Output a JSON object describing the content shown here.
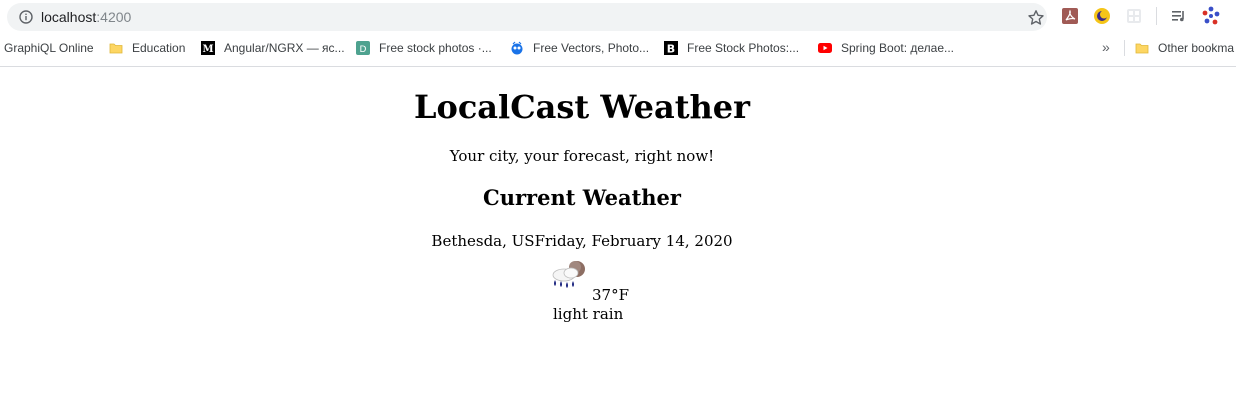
{
  "browser": {
    "url_host": "localhost",
    "url_port": ":4200",
    "bookmarks": [
      {
        "label": "GraphiQL Online",
        "icon": "none"
      },
      {
        "label": "Education",
        "icon": "folder-icon"
      },
      {
        "label": "Angular/NGRX — яс...",
        "icon": "medium-icon"
      },
      {
        "label": "Free stock photos ·...",
        "icon": "d-icon"
      },
      {
        "label": "Free Vectors, Photo...",
        "icon": "freepik-icon"
      },
      {
        "label": "Free Stock Photos:...",
        "icon": "b-icon"
      },
      {
        "label": "Spring Boot: делае...",
        "icon": "youtube-icon"
      },
      {
        "label": "Other bookma",
        "icon": "folder-icon"
      }
    ],
    "more_label": "»"
  },
  "page": {
    "title": "LocalCast Weather",
    "tagline": "Your city, your forecast, right now!",
    "section_title": "Current Weather",
    "location": "Bethesda, USFriday, February 14, 2020",
    "temperature": "37°F",
    "description": "light rain",
    "weather_icon": "light-rain-icon"
  }
}
